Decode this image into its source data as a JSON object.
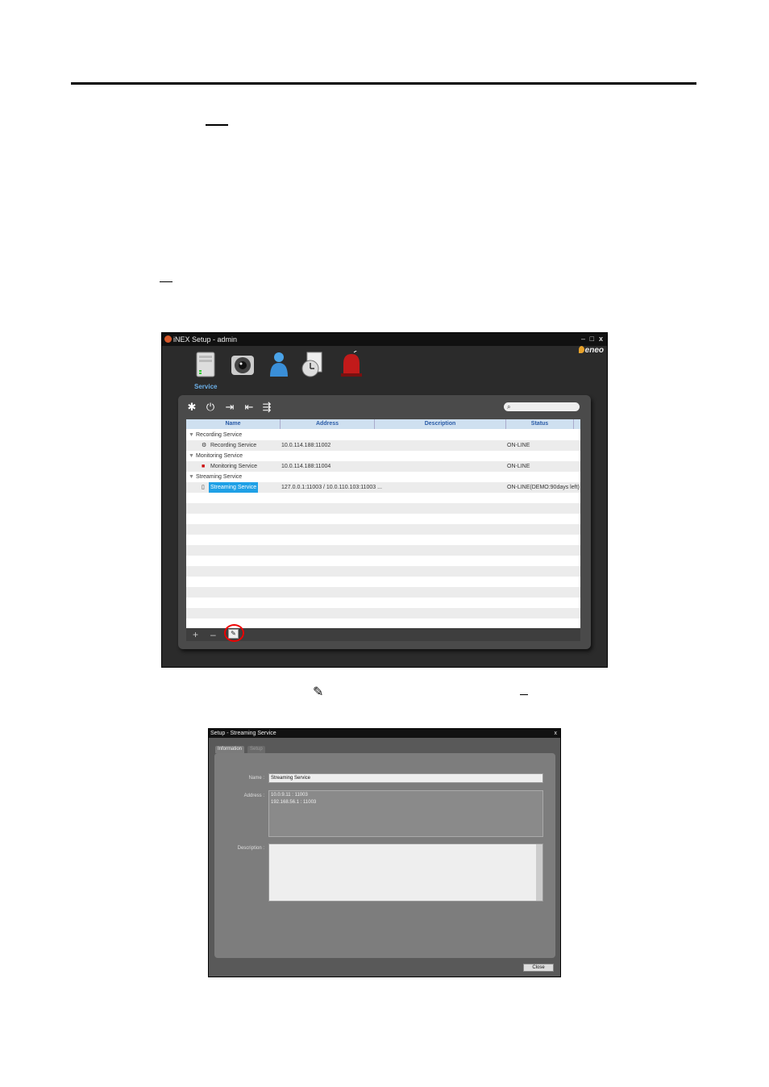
{
  "main_window": {
    "title": "iNEX Setup - admin",
    "controls": {
      "minimize": "–",
      "maximize": "□",
      "close": "x"
    },
    "logo": "eneo",
    "top_nav": [
      {
        "icon": "server-icon",
        "label": "Service"
      },
      {
        "icon": "camera-icon",
        "label": ""
      },
      {
        "icon": "user-icon",
        "label": ""
      },
      {
        "icon": "schedule-icon",
        "label": ""
      },
      {
        "icon": "alarm-icon",
        "label": ""
      }
    ],
    "toolbar_icons": [
      "gear-icon",
      "power-icon",
      "login-icon",
      "logout-icon",
      "route-icon"
    ],
    "search_icon": "⌕",
    "columns": [
      "Name",
      "Address",
      "Description",
      "Status"
    ],
    "rows": [
      {
        "type": "group",
        "name": "Recording Service"
      },
      {
        "type": "item",
        "name": "Recording Service",
        "address": "10.0.114.188:11002",
        "description": "",
        "status": "ON-LINE"
      },
      {
        "type": "group",
        "name": "Monitoring Service"
      },
      {
        "type": "item",
        "name": "Monitoring Service",
        "address": "10.0.114.188:11004",
        "description": "",
        "status": "ON-LINE"
      },
      {
        "type": "group",
        "name": "Streaming Service"
      },
      {
        "type": "item",
        "name": "Streaming Service",
        "address": "127.0.0.1:11003  /  10.0.110.103:11003  ...",
        "description": "",
        "status": "ON-LINE(DEMO:90days left)",
        "selected": true
      }
    ],
    "bottom_buttons": {
      "add": "+",
      "remove": "–",
      "edit": "✎"
    }
  },
  "caption_icon": "✎",
  "dialog": {
    "title": "Setup - Streaming Service",
    "close_x": "x",
    "tabs": [
      "Information",
      "Setup"
    ],
    "name_label": "Name :",
    "name_value": "Streaming Service",
    "address_label": "Address :",
    "addresses": [
      "10.0.9.11 : 11003",
      "192.168.56.1 : 11003"
    ],
    "description_label": "Description :",
    "description_value": "",
    "close_button": "Close"
  },
  "colors": {
    "selection": "#1fa0e6",
    "highlight_circle": "#e00000",
    "header_text": "#2a5ca8"
  }
}
